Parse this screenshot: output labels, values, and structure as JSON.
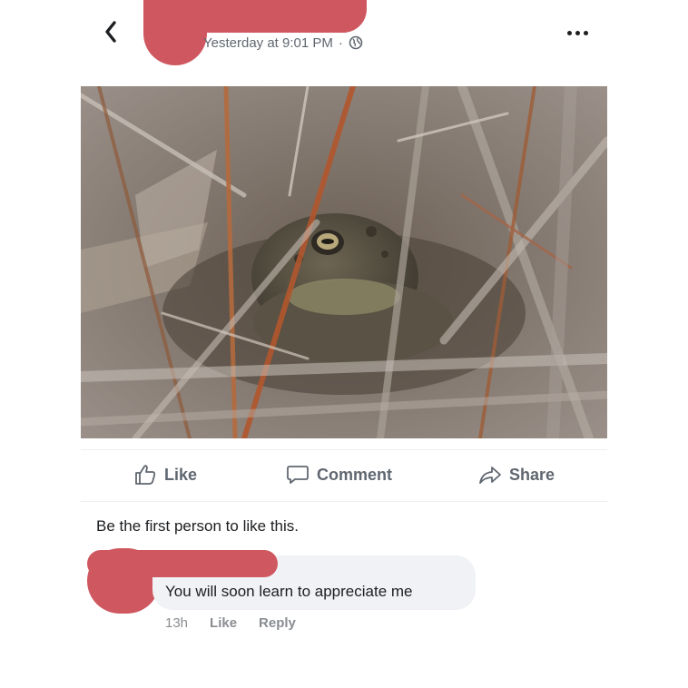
{
  "post": {
    "timestamp": "Yesterday at 9:01 PM",
    "separator": "·",
    "privacy_icon": "globe-icon",
    "back_icon": "chevron-left-icon",
    "more_icon": "more-horizontal-icon"
  },
  "actions": {
    "like_label": "Like",
    "comment_label": "Comment",
    "share_label": "Share"
  },
  "likes_text": "Be the first person to like this.",
  "comment": {
    "text": "You will soon learn to appreciate me",
    "time": "13h",
    "like_label": "Like",
    "reply_label": "Reply"
  },
  "colors": {
    "redaction": "#cf5860",
    "text_primary": "#1c1e21",
    "text_secondary": "#606770",
    "bubble": "#f0f2f5"
  }
}
